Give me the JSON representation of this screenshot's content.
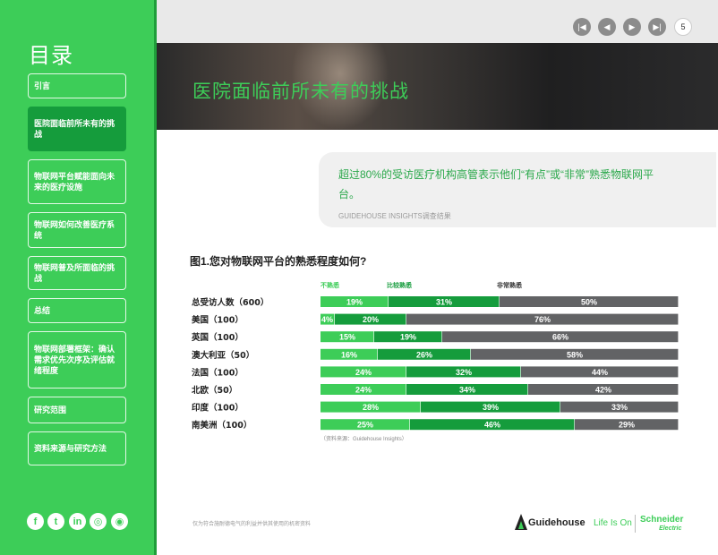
{
  "sidebar": {
    "title": "目录",
    "items": [
      {
        "label": "引言",
        "active": false
      },
      {
        "label": "医院面临前所未有的挑战",
        "active": true
      },
      {
        "label": "物联网平台赋能面向未来的医疗设施",
        "active": false
      },
      {
        "label": "物联网如何改善医疗系统",
        "active": false
      },
      {
        "label": "物联网普及所面临的挑战",
        "active": false
      },
      {
        "label": "总结",
        "active": false
      },
      {
        "label": "物联网部署框架：确认需求优先次序及评估就绪程度",
        "active": false
      },
      {
        "label": "研究范围",
        "active": false
      },
      {
        "label": "资料来源与研究方法",
        "active": false
      }
    ],
    "social_icons": [
      "facebook-icon",
      "twitter-icon",
      "linkedin-icon",
      "instagram-icon",
      "rss-icon"
    ]
  },
  "pager": {
    "page": "5"
  },
  "hero": {
    "title": "医院面临前所未有的挑战"
  },
  "callout": {
    "text": "超过80%的受访医疗机构高管表示他们“有点”或“非常”熟悉物联网平台。",
    "source": "GUIDEHOUSE INSIGHTS调查结果"
  },
  "chart_title": "图1.您对物联网平台的熟悉程度如何?",
  "chart_source": "（资料来源：Guidehouse Insights）",
  "footer": {
    "disclaimer": "仅为符合施耐德电气的利益并供其使用的机密资料",
    "guidehouse": "Guidehouse",
    "lifeison": "Life Is On",
    "schneider": "Schneider",
    "schneider_sub": "Electric"
  },
  "colors": {
    "accent": "#3dcd58",
    "somewhat": "#3dcd58",
    "fairly": "#159c3c",
    "very": "#626365"
  },
  "chart_data": {
    "type": "bar",
    "orientation": "horizontal",
    "stacked": true,
    "title": "图1.您对物联网平台的熟悉程度如何?",
    "categories": [
      "总受访人数（600）",
      "美国（100）",
      "英国（100）",
      "澳大利亚（50）",
      "法国（100）",
      "北欧（50）",
      "印度（100）",
      "南美洲（100）"
    ],
    "series": [
      {
        "name": "不熟悉",
        "color": "#3dcd58",
        "values": [
          19,
          4,
          15,
          16,
          24,
          24,
          28,
          25
        ]
      },
      {
        "name": "比较熟悉",
        "color": "#159c3c",
        "values": [
          31,
          20,
          19,
          26,
          32,
          34,
          39,
          46
        ]
      },
      {
        "name": "非常熟悉",
        "color": "#626365",
        "values": [
          50,
          76,
          66,
          58,
          44,
          42,
          33,
          29
        ]
      }
    ],
    "xlim": [
      0,
      100
    ],
    "unit": "%",
    "legend_position": "top"
  }
}
